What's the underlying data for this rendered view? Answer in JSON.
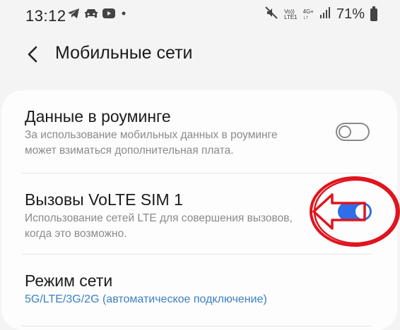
{
  "status_bar": {
    "time": "13:12",
    "left_icons": [
      "telegram-icon",
      "car-icon",
      "youtube-icon",
      "dot-icon"
    ],
    "network_top": "Vo))",
    "network_bottom": "LTE1",
    "network_type_top": "4G+",
    "network_type_bottom": "↓↑",
    "battery_percent": "71%"
  },
  "header": {
    "title": "Мобильные сети"
  },
  "settings": [
    {
      "title": "Данные в роуминге",
      "description": "За использование мобильных данных в роуминге может взиматься дополнительная плата.",
      "toggle": false
    },
    {
      "title": "Вызовы VoLTE SIM 1",
      "description": "Использование сетей LTE для совершения вызовов, когда это возможно.",
      "toggle": true
    },
    {
      "title": "Режим сети",
      "subtitle": "5G/LTE/3G/2G (автоматическое подключение)"
    }
  ],
  "colors": {
    "accent": "#2f6ee6",
    "link": "#3d7fc1",
    "annotation": "#e0141e"
  }
}
